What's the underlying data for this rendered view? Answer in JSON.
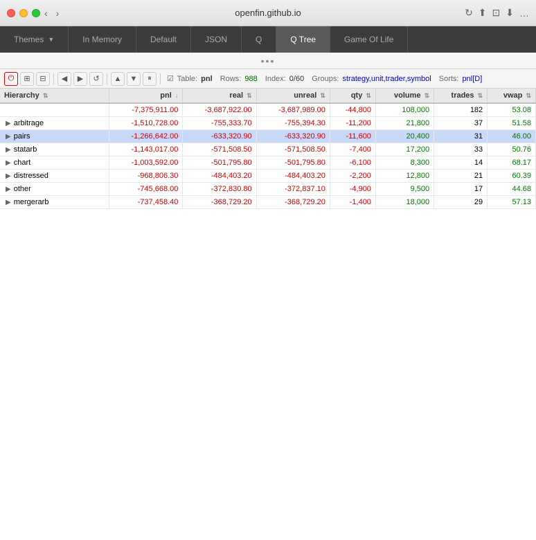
{
  "titlebar": {
    "title": "openfin.github.io",
    "traffic_lights": [
      "close",
      "minimize",
      "maximize"
    ]
  },
  "tabs": [
    {
      "id": "themes",
      "label": "Themes",
      "active": false,
      "has_arrow": true
    },
    {
      "id": "in-memory",
      "label": "In Memory",
      "active": false
    },
    {
      "id": "default",
      "label": "Default",
      "active": false
    },
    {
      "id": "json",
      "label": "JSON",
      "active": false
    },
    {
      "id": "q",
      "label": "Q",
      "active": false
    },
    {
      "id": "q-tree",
      "label": "Q Tree",
      "active": true
    },
    {
      "id": "game-of-life",
      "label": "Game Of Life",
      "active": false
    }
  ],
  "toolbar": {
    "dots": "•••",
    "buttons": [
      {
        "id": "power",
        "icon": "⏻",
        "label": "power"
      },
      {
        "id": "group1",
        "icon": "⊞",
        "label": "group"
      },
      {
        "id": "group2",
        "icon": "⊟",
        "label": "ungroup"
      },
      {
        "id": "back",
        "icon": "◀",
        "label": "back"
      },
      {
        "id": "forward",
        "icon": "▶",
        "label": "forward"
      },
      {
        "id": "reset",
        "icon": "↺",
        "label": "reset"
      },
      {
        "id": "up",
        "icon": "▲",
        "label": "up"
      },
      {
        "id": "down",
        "icon": "▼",
        "label": "down"
      },
      {
        "id": "pause",
        "icon": "⏸",
        "label": "pause"
      }
    ],
    "info": {
      "table_label": "Table:",
      "table_value": "pnl",
      "rows_label": "Rows:",
      "rows_value": "988",
      "index_label": "Index:",
      "index_value": "0/60",
      "groups_label": "Groups:",
      "groups_value": "strategy,unit,trader,symbol",
      "sorts_label": "Sorts:",
      "sorts_value": "pnl[D]"
    }
  },
  "table": {
    "columns": [
      {
        "id": "hierarchy",
        "label": "Hierarchy",
        "sort": "both"
      },
      {
        "id": "pnl",
        "label": "pnl",
        "sort": "desc"
      },
      {
        "id": "real",
        "label": "real",
        "sort": "both"
      },
      {
        "id": "unreal",
        "label": "unreal",
        "sort": "both"
      },
      {
        "id": "qty",
        "label": "qty",
        "sort": "both"
      },
      {
        "id": "volume",
        "label": "volume",
        "sort": "both"
      },
      {
        "id": "trades",
        "label": "trades",
        "sort": "both"
      },
      {
        "id": "vwap",
        "label": "vwap",
        "sort": "both"
      }
    ],
    "rows": [
      {
        "id": "total",
        "hierarchy": "",
        "expandable": false,
        "selected": false,
        "pnl": "-7,375,911.00",
        "real": "-3,687,922.00",
        "unreal": "-3,687,989.00",
        "qty": "-44,800",
        "volume": "108,000",
        "trades": "182",
        "vwap": "53.08",
        "pnl_color": "red",
        "real_color": "red",
        "unreal_color": "red",
        "qty_color": "red",
        "volume_color": "green",
        "vwap_color": "green"
      },
      {
        "id": "arbitrage",
        "hierarchy": "arbitrage",
        "expandable": true,
        "selected": false,
        "pnl": "-1,510,728.00",
        "real": "-755,333.70",
        "unreal": "-755,394.30",
        "qty": "-11,200",
        "volume": "21,800",
        "trades": "37",
        "vwap": "51.58",
        "pnl_color": "red",
        "real_color": "red",
        "unreal_color": "red",
        "qty_color": "red",
        "volume_color": "green",
        "vwap_color": "green"
      },
      {
        "id": "pairs",
        "hierarchy": "pairs",
        "expandable": true,
        "selected": true,
        "pnl": "-1,266,642.00",
        "real": "-633,320.90",
        "unreal": "-633,320.90",
        "qty": "-11,600",
        "volume": "20,400",
        "trades": "31",
        "vwap": "46.00",
        "pnl_color": "red",
        "real_color": "red",
        "unreal_color": "red",
        "qty_color": "red",
        "volume_color": "green",
        "vwap_color": "green"
      },
      {
        "id": "statarb",
        "hierarchy": "statarb",
        "expandable": true,
        "selected": false,
        "pnl": "-1,143,017.00",
        "real": "-571,508.50",
        "unreal": "-571,508.50",
        "qty": "-7,400",
        "volume": "17,200",
        "trades": "33",
        "vwap": "50.76",
        "pnl_color": "red",
        "real_color": "red",
        "unreal_color": "red",
        "qty_color": "red",
        "volume_color": "green",
        "vwap_color": "green"
      },
      {
        "id": "chart",
        "hierarchy": "chart",
        "expandable": true,
        "selected": false,
        "pnl": "-1,003,592.00",
        "real": "-501,795.80",
        "unreal": "-501,795.80",
        "qty": "-6,100",
        "volume": "8,300",
        "trades": "14",
        "vwap": "68.17",
        "pnl_color": "red",
        "real_color": "red",
        "unreal_color": "red",
        "qty_color": "red",
        "volume_color": "green",
        "vwap_color": "green"
      },
      {
        "id": "distressed",
        "hierarchy": "distressed",
        "expandable": true,
        "selected": false,
        "pnl": "-968,806.30",
        "real": "-484,403.20",
        "unreal": "-484,403.20",
        "qty": "-2,200",
        "volume": "12,800",
        "trades": "21",
        "vwap": "60.39",
        "pnl_color": "red",
        "real_color": "red",
        "unreal_color": "red",
        "qty_color": "red",
        "volume_color": "green",
        "vwap_color": "green"
      },
      {
        "id": "other",
        "hierarchy": "other",
        "expandable": true,
        "selected": false,
        "pnl": "-745,668.00",
        "real": "-372,830.80",
        "unreal": "-372,837.10",
        "qty": "-4,900",
        "volume": "9,500",
        "trades": "17",
        "vwap": "44.68",
        "pnl_color": "red",
        "real_color": "red",
        "unreal_color": "red",
        "qty_color": "red",
        "volume_color": "green",
        "vwap_color": "green"
      },
      {
        "id": "mergerarb",
        "hierarchy": "mergerarb",
        "expandable": true,
        "selected": false,
        "pnl": "-737,458.40",
        "real": "-368,729.20",
        "unreal": "-368,729.20",
        "qty": "-1,400",
        "volume": "18,000",
        "trades": "29",
        "vwap": "57.13",
        "pnl_color": "red",
        "real_color": "red",
        "unreal_color": "red",
        "qty_color": "red",
        "volume_color": "green",
        "vwap_color": "green"
      }
    ]
  }
}
